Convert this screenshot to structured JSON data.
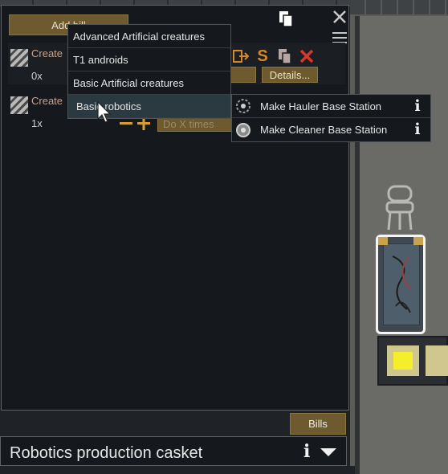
{
  "panel": {
    "add_bill_label": "Add bill",
    "bills": [
      {
        "title": "Create",
        "count": "0x",
        "details_label": "Details..."
      },
      {
        "title": "Create",
        "count": "1x",
        "repeat_label": "Do X times"
      }
    ]
  },
  "dropdown": {
    "items": [
      {
        "label": "Advanced Artificial  creatures"
      },
      {
        "label": "T1 androids"
      },
      {
        "label": "Basic Artificial  creatures"
      },
      {
        "label": "Basic robotics"
      }
    ]
  },
  "submenu": {
    "items": [
      {
        "label": "Make Hauler Base Station",
        "icon": "hauler-station-icon"
      },
      {
        "label": "Make Cleaner Base Station",
        "icon": "cleaner-station-icon"
      }
    ],
    "info_glyph": "i"
  },
  "bottom": {
    "bills_tab_label": "Bills",
    "inspect_title": "Robotics production casket"
  },
  "colors": {
    "panel_bg": "#15181c",
    "button_brown": "#6e5a2f",
    "delete_red": "#d43a2a",
    "suspend_orange": "#d6892a",
    "highlight": "#2a3a40"
  }
}
